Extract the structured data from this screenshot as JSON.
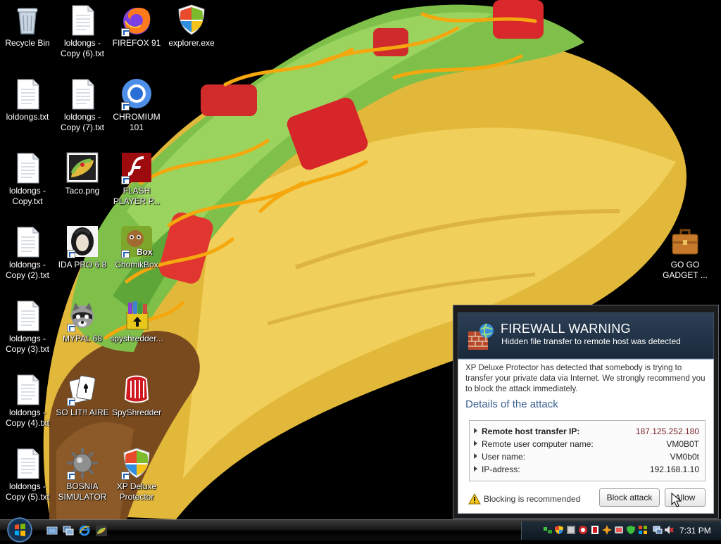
{
  "desktop": {
    "icons": [
      {
        "label": "Recycle Bin",
        "icon": "recycle-bin-icon"
      },
      {
        "label": "loldongs - Copy (6).txt",
        "icon": "text-file-icon"
      },
      {
        "label": "FIREFOX 91",
        "icon": "firefox-icon"
      },
      {
        "label": "explorer.exe",
        "icon": "shield-icon"
      },
      {
        "label": "loldongs.txt",
        "icon": "text-file-icon"
      },
      {
        "label": "loldongs - Copy (7).txt",
        "icon": "text-file-icon"
      },
      {
        "label": "CHROMIUM 101",
        "icon": "chromium-icon"
      },
      {
        "label": "loldongs - Copy.txt",
        "icon": "text-file-icon"
      },
      {
        "label": "Taco.png",
        "icon": "taco-image-icon"
      },
      {
        "label": "FLASH PLAYER P...",
        "icon": "flash-player-icon"
      },
      {
        "label": "loldongs - Copy (2).txt",
        "icon": "text-file-icon"
      },
      {
        "label": "IDA PRO 6.8",
        "icon": "ida-pro-icon"
      },
      {
        "label": "ChomikBox",
        "icon": "chomikbox-icon"
      },
      {
        "label": "GO GO GADGET ...",
        "icon": "briefcase-icon"
      },
      {
        "label": "loldongs - Copy (3).txt",
        "icon": "text-file-icon"
      },
      {
        "label": "MYPAL 68",
        "icon": "raccoon-icon"
      },
      {
        "label": "spyshredder...",
        "icon": "installer-box-icon"
      },
      {
        "label": "loldongs - Copy (4).txt",
        "icon": "text-file-icon"
      },
      {
        "label": "SO LIT!! AIRE",
        "icon": "solitaire-cards-icon"
      },
      {
        "label": "SpyShredder",
        "icon": "spyshredder-icon"
      },
      {
        "label": "loldongs - Copy (5).txt",
        "icon": "text-file-icon"
      },
      {
        "label": "BOSNIA SIMULATOR",
        "icon": "spiked-mine-icon"
      },
      {
        "label": "XP Deluxe Protector",
        "icon": "shield-icon"
      }
    ]
  },
  "firewall": {
    "title": "FIREWALL WARNING",
    "subtitle": "Hidden file transfer to remote host was detected",
    "description": "XP Deluxe Protector has detected that somebody is trying to transfer your private data via Internet. We strongly recommend you to block the attack immediately.",
    "details_title": "Details of the attack",
    "details": [
      {
        "key": "Remote host transfer IP:",
        "value": "187.125.252.180"
      },
      {
        "key": "Remote user computer name:",
        "value": "VM0B0T"
      },
      {
        "key": "User name:",
        "value": "VM0b0t"
      },
      {
        "key": "IP-adress:",
        "value": "192.168.1.10"
      }
    ],
    "recommendation": "Blocking is recommended",
    "block_label": "Block attack",
    "allow_label": "Allow"
  },
  "taskbar": {
    "clock": "7:31 PM",
    "quick_launch": [
      "show-desktop-icon",
      "switch-windows-icon",
      "internet-explorer-icon",
      "taco-app-icon"
    ],
    "tray_icons": [
      "network-green-icon",
      "shield-tray-icon",
      "app-tray-icon",
      "app-tray-icon-2",
      "red-tray-icon",
      "burst-tray-icon",
      "app-tray-icon-3",
      "green-shield-tray-icon",
      "windows-tray-icon",
      "monitor-network-icon",
      "volume-muted-icon",
      "safely-remove-icon"
    ]
  }
}
